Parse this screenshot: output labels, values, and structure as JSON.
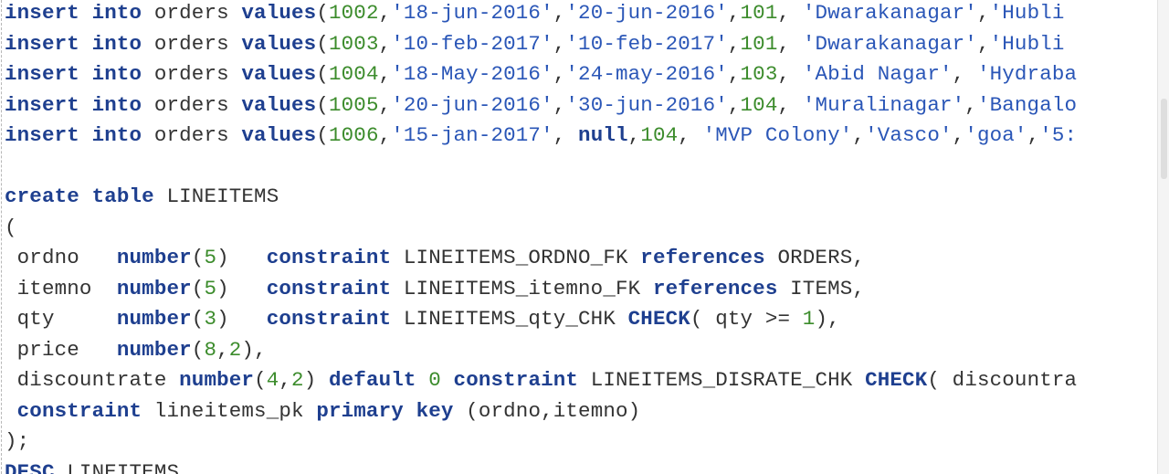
{
  "editor": {
    "lines": [
      [
        {
          "t": "insert",
          "c": "kw"
        },
        {
          "t": " "
        },
        {
          "t": "into",
          "c": "kw"
        },
        {
          "t": " orders "
        },
        {
          "t": "values",
          "c": "kw"
        },
        {
          "t": "("
        },
        {
          "t": "1002",
          "c": "num"
        },
        {
          "t": ","
        },
        {
          "t": "'18-jun-2016'",
          "c": "str"
        },
        {
          "t": ","
        },
        {
          "t": "'20-jun-2016'",
          "c": "str"
        },
        {
          "t": ","
        },
        {
          "t": "101",
          "c": "num"
        },
        {
          "t": ", "
        },
        {
          "t": "'Dwarakanagar'",
          "c": "str"
        },
        {
          "t": ","
        },
        {
          "t": "'Hubli",
          "c": "str"
        }
      ],
      [
        {
          "t": "insert",
          "c": "kw"
        },
        {
          "t": " "
        },
        {
          "t": "into",
          "c": "kw"
        },
        {
          "t": " orders "
        },
        {
          "t": "values",
          "c": "kw"
        },
        {
          "t": "("
        },
        {
          "t": "1003",
          "c": "num"
        },
        {
          "t": ","
        },
        {
          "t": "'10-feb-2017'",
          "c": "str"
        },
        {
          "t": ","
        },
        {
          "t": "'10-feb-2017'",
          "c": "str"
        },
        {
          "t": ","
        },
        {
          "t": "101",
          "c": "num"
        },
        {
          "t": ", "
        },
        {
          "t": "'Dwarakanagar'",
          "c": "str"
        },
        {
          "t": ","
        },
        {
          "t": "'Hubli",
          "c": "str"
        }
      ],
      [
        {
          "t": "insert",
          "c": "kw"
        },
        {
          "t": " "
        },
        {
          "t": "into",
          "c": "kw"
        },
        {
          "t": " orders "
        },
        {
          "t": "values",
          "c": "kw"
        },
        {
          "t": "("
        },
        {
          "t": "1004",
          "c": "num"
        },
        {
          "t": ","
        },
        {
          "t": "'18-May-2016'",
          "c": "str"
        },
        {
          "t": ","
        },
        {
          "t": "'24-may-2016'",
          "c": "str"
        },
        {
          "t": ","
        },
        {
          "t": "103",
          "c": "num"
        },
        {
          "t": ", "
        },
        {
          "t": "'Abid Nagar'",
          "c": "str"
        },
        {
          "t": ", "
        },
        {
          "t": "'Hydraba",
          "c": "str"
        }
      ],
      [
        {
          "t": "insert",
          "c": "kw"
        },
        {
          "t": " "
        },
        {
          "t": "into",
          "c": "kw"
        },
        {
          "t": " orders "
        },
        {
          "t": "values",
          "c": "kw"
        },
        {
          "t": "("
        },
        {
          "t": "1005",
          "c": "num"
        },
        {
          "t": ","
        },
        {
          "t": "'20-jun-2016'",
          "c": "str"
        },
        {
          "t": ","
        },
        {
          "t": "'30-jun-2016'",
          "c": "str"
        },
        {
          "t": ","
        },
        {
          "t": "104",
          "c": "num"
        },
        {
          "t": ", "
        },
        {
          "t": "'Muralinagar'",
          "c": "str"
        },
        {
          "t": ","
        },
        {
          "t": "'Bangalo",
          "c": "str"
        }
      ],
      [
        {
          "t": "insert",
          "c": "kw"
        },
        {
          "t": " "
        },
        {
          "t": "into",
          "c": "kw"
        },
        {
          "t": " orders "
        },
        {
          "t": "values",
          "c": "kw"
        },
        {
          "t": "("
        },
        {
          "t": "1006",
          "c": "num"
        },
        {
          "t": ","
        },
        {
          "t": "'15-jan-2017'",
          "c": "str"
        },
        {
          "t": ", "
        },
        {
          "t": "null",
          "c": "kw"
        },
        {
          "t": ","
        },
        {
          "t": "104",
          "c": "num"
        },
        {
          "t": ", "
        },
        {
          "t": "'MVP Colony'",
          "c": "str"
        },
        {
          "t": ","
        },
        {
          "t": "'Vasco'",
          "c": "str"
        },
        {
          "t": ","
        },
        {
          "t": "'goa'",
          "c": "str"
        },
        {
          "t": ","
        },
        {
          "t": "'5:",
          "c": "str"
        }
      ],
      [],
      [
        {
          "t": "create",
          "c": "kw"
        },
        {
          "t": " "
        },
        {
          "t": "table",
          "c": "kw"
        },
        {
          "t": " LINEITEMS"
        }
      ],
      [
        {
          "t": "("
        }
      ],
      [
        {
          "t": " ordno   "
        },
        {
          "t": "number",
          "c": "kw"
        },
        {
          "t": "("
        },
        {
          "t": "5",
          "c": "num"
        },
        {
          "t": ")   "
        },
        {
          "t": "constraint",
          "c": "kw"
        },
        {
          "t": " LINEITEMS_ORDNO_FK "
        },
        {
          "t": "references",
          "c": "kw"
        },
        {
          "t": " ORDERS,"
        }
      ],
      [
        {
          "t": " itemno  "
        },
        {
          "t": "number",
          "c": "kw"
        },
        {
          "t": "("
        },
        {
          "t": "5",
          "c": "num"
        },
        {
          "t": ")   "
        },
        {
          "t": "constraint",
          "c": "kw"
        },
        {
          "t": " LINEITEMS_itemno_FK "
        },
        {
          "t": "references",
          "c": "kw"
        },
        {
          "t": " ITEMS,"
        }
      ],
      [
        {
          "t": " qty     "
        },
        {
          "t": "number",
          "c": "kw"
        },
        {
          "t": "("
        },
        {
          "t": "3",
          "c": "num"
        },
        {
          "t": ")   "
        },
        {
          "t": "constraint",
          "c": "kw"
        },
        {
          "t": " LINEITEMS_qty_CHK "
        },
        {
          "t": "CHECK",
          "c": "kw"
        },
        {
          "t": "( qty >= "
        },
        {
          "t": "1",
          "c": "num"
        },
        {
          "t": "),"
        }
      ],
      [
        {
          "t": " price   "
        },
        {
          "t": "number",
          "c": "kw"
        },
        {
          "t": "("
        },
        {
          "t": "8",
          "c": "num"
        },
        {
          "t": ","
        },
        {
          "t": "2",
          "c": "num"
        },
        {
          "t": "),"
        }
      ],
      [
        {
          "t": " discountrate "
        },
        {
          "t": "number",
          "c": "kw"
        },
        {
          "t": "("
        },
        {
          "t": "4",
          "c": "num"
        },
        {
          "t": ","
        },
        {
          "t": "2",
          "c": "num"
        },
        {
          "t": ") "
        },
        {
          "t": "default",
          "c": "kw"
        },
        {
          "t": " "
        },
        {
          "t": "0",
          "c": "num"
        },
        {
          "t": " "
        },
        {
          "t": "constraint",
          "c": "kw"
        },
        {
          "t": " LINEITEMS_DISRATE_CHK "
        },
        {
          "t": "CHECK",
          "c": "kw"
        },
        {
          "t": "( discountra"
        }
      ],
      [
        {
          "t": " "
        },
        {
          "t": "constraint",
          "c": "kw"
        },
        {
          "t": " lineitems_pk "
        },
        {
          "t": "primary",
          "c": "kw"
        },
        {
          "t": " "
        },
        {
          "t": "key",
          "c": "kw"
        },
        {
          "t": " (ordno,itemno)"
        }
      ],
      [
        {
          "t": ");"
        }
      ],
      [
        {
          "t": "DESC",
          "c": "kw"
        },
        {
          "t": " LINEITEMS"
        }
      ]
    ]
  },
  "colors": {
    "keyword": "#1e3f8f",
    "number": "#3c8c2c",
    "string": "#2a56b7",
    "plain": "#333333",
    "background": "#ffffff"
  }
}
